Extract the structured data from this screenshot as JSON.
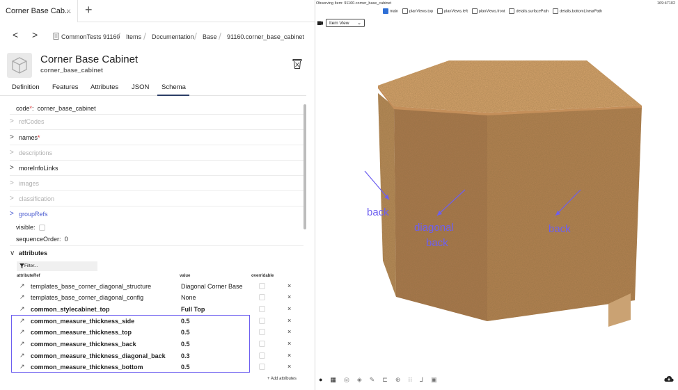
{
  "tab": {
    "title": "Corner Base Cab...",
    "close": "×",
    "add": "+"
  },
  "nav": {
    "back": "<",
    "forward": ">",
    "breadcrumbs": [
      "CommonTests 91160",
      "Items",
      "Documentation",
      "Base",
      "91160.corner_base_cabinet"
    ]
  },
  "item": {
    "title": "Corner Base Cabinet",
    "subtitle": "corner_base_cabinet"
  },
  "subtabs": [
    "Definition",
    "Features",
    "Attributes",
    "JSON",
    "Schema"
  ],
  "schema": {
    "code_label": "code",
    "code_value": "corner_base_cabinet",
    "refcodes": "refCodes",
    "names": "names",
    "descriptions": "descriptions",
    "moreinfolinks": "moreInfoLinks",
    "images": "images",
    "classification": "classification",
    "grouprefs": "groupRefs",
    "visible": "visible:",
    "sequence_label": "sequenceOrder:",
    "sequence_value": "0",
    "attributes": "attributes",
    "required_mark": "*",
    "colon": ":"
  },
  "attr_table": {
    "filter": "Filter...",
    "col_ref": "attributeRef",
    "col_value": "value",
    "col_overridable": "overridable",
    "rows": [
      {
        "ref": "templates_base_corner_diagonal_structure",
        "value": "Diagonal Corner Base",
        "bold": false
      },
      {
        "ref": "templates_base_corner_diagonal_config",
        "value": "None",
        "bold": false
      },
      {
        "ref": "common_stylecabinet_top",
        "value": "Full Top",
        "bold": true
      },
      {
        "ref": "common_measure_thickness_side",
        "value": "0.5",
        "bold": true
      },
      {
        "ref": "common_measure_thickness_top",
        "value": "0.5",
        "bold": true
      },
      {
        "ref": "common_measure_thickness_back",
        "value": "0.5",
        "bold": true
      },
      {
        "ref": "common_measure_thickness_diagonal_back",
        "value": "0.3",
        "bold": true
      },
      {
        "ref": "common_measure_thickness_bottom",
        "value": "0.5",
        "bold": true
      }
    ],
    "remove": "×",
    "add": "+ Add attributes"
  },
  "viewer": {
    "observing": "Observing Item: 91160.corner_base_cabinet",
    "coord": "169:47102",
    "checks": [
      {
        "label": "main",
        "checked": true
      },
      {
        "label": "planViews.top",
        "checked": false
      },
      {
        "label": "planViews.left",
        "checked": false
      },
      {
        "label": "planViews.front",
        "checked": false
      },
      {
        "label": "details.surfacePath",
        "checked": false
      },
      {
        "label": "details.bottomLinearPath",
        "checked": false
      }
    ],
    "view_select": "Item View",
    "annotations": {
      "back_left": "back",
      "diagonal_1": "diagonal",
      "diagonal_2": "back",
      "back_right": "back"
    },
    "annotation_color": "#6d5ff0",
    "wood_top": "#d9a66e",
    "wood_side": "#a9784c"
  }
}
